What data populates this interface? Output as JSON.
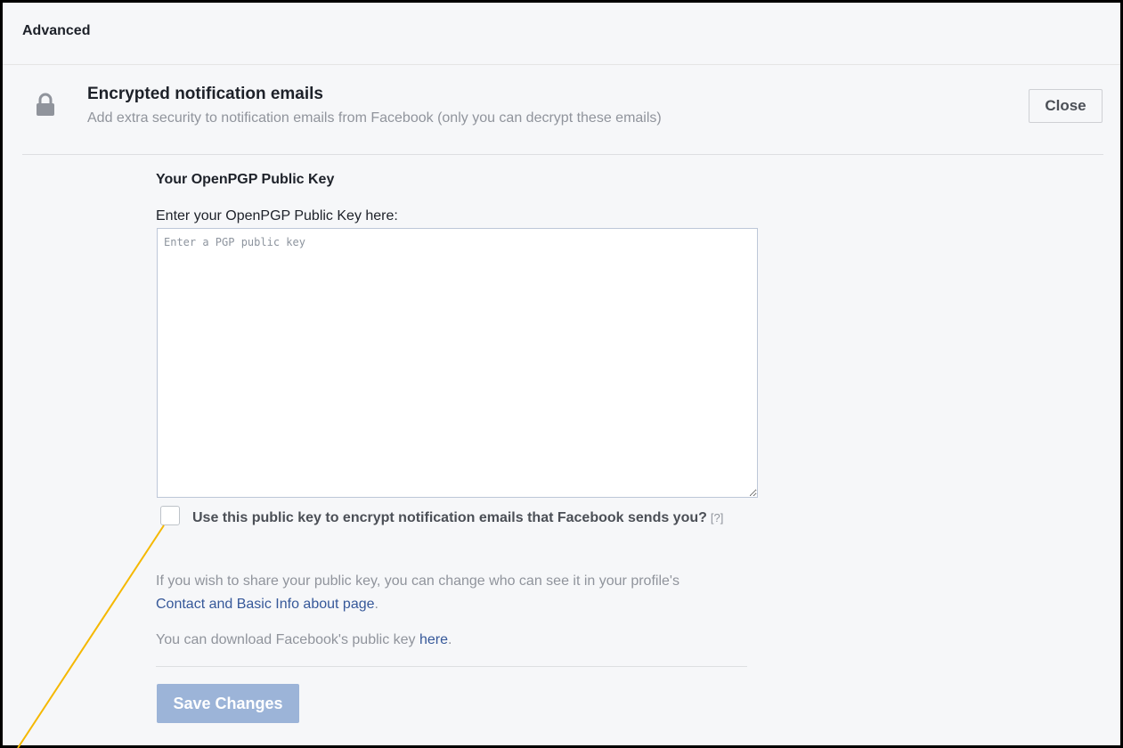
{
  "header": {
    "title": "Advanced"
  },
  "section": {
    "title": "Encrypted notification emails",
    "subtitle": "Add extra security to notification emails from Facebook (only you can decrypt these emails)",
    "close_label": "Close"
  },
  "form": {
    "key_title": "Your OpenPGP Public Key",
    "key_label": "Enter your OpenPGP Public Key here:",
    "key_value": "",
    "key_placeholder": "Enter a PGP public key",
    "checkbox_label": "Use this public key to encrypt notification emails that Facebook sends you?",
    "checkbox_checked": false,
    "help_link": "[?]",
    "share_text_1": "If you wish to share your public key, you can change who can see it in your profile's",
    "share_link": "Contact and Basic Info about page",
    "share_text_2": ".",
    "download_text": "You can download Facebook's public key",
    "download_link": "here",
    "download_text_2": ".",
    "save_label": "Save Changes"
  },
  "icons": {
    "lock": "lock-icon"
  },
  "colors": {
    "link": "#365899",
    "save_button_disabled": "#9cb4d8",
    "annotation_line": "#f5b800"
  }
}
